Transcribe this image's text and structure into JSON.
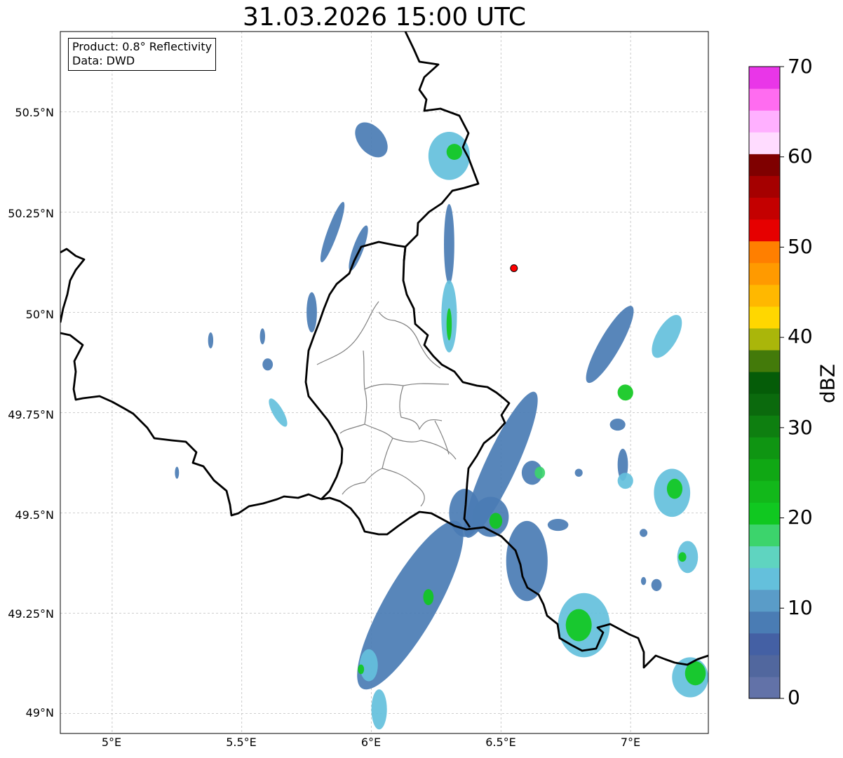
{
  "title": "31.03.2026 15:00 UTC",
  "info": {
    "product": "Product: 0.8° Reflectivity",
    "data": "Data: DWD"
  },
  "map": {
    "lon_range": [
      4.8,
      7.3
    ],
    "lat_range": [
      48.95,
      50.7
    ],
    "lat_ticks": [
      "50.5°N",
      "50.25°N",
      "50°N",
      "49.75°N",
      "49.5°N",
      "49.25°N",
      "49°N"
    ],
    "lon_ticks": [
      "5°E",
      "5.5°E",
      "6°E",
      "6.5°E",
      "7°E"
    ],
    "gridlines": true,
    "radar_site": {
      "lon": 6.55,
      "lat": 50.11,
      "color": "#ff0000"
    }
  },
  "colorbar": {
    "label": "dBZ",
    "min": 0,
    "max": 70,
    "ticks": [
      "0",
      "10",
      "20",
      "30",
      "40",
      "50",
      "60",
      "70"
    ],
    "colors": [
      "#6272a8",
      "#51679e",
      "#4460a4",
      "#4a7cb4",
      "#5a9cc8",
      "#64c0dc",
      "#5fd4c0",
      "#3cd46c",
      "#10c820",
      "#12b81a",
      "#10a814",
      "#0f9512",
      "#0e7f10",
      "#0b6a0d",
      "#055c08",
      "#437a0a",
      "#aab60a",
      "#ffd700",
      "#ffb800",
      "#ff9a00",
      "#ff7f00",
      "#e60000",
      "#c40000",
      "#a50000",
      "#7f0000",
      "#ffdcff",
      "#ffb0ff",
      "#ff6cf0",
      "#e936e8"
    ]
  },
  "echoes": [
    {
      "lon": 6.0,
      "lat": 50.43,
      "rx": 0.05,
      "ry": 0.05,
      "a": -40,
      "level": 1
    },
    {
      "lon": 6.3,
      "lat": 50.39,
      "rx": 0.08,
      "ry": 0.06,
      "a": 0,
      "level": 2
    },
    {
      "lon": 6.32,
      "lat": 50.4,
      "rx": 0.03,
      "ry": 0.02,
      "a": 0,
      "level": 4
    },
    {
      "lon": 6.3,
      "lat": 50.17,
      "rx": 0.02,
      "ry": 0.1,
      "a": 0,
      "level": 1
    },
    {
      "lon": 5.95,
      "lat": 50.16,
      "rx": 0.02,
      "ry": 0.06,
      "a": 20,
      "level": 1
    },
    {
      "lon": 5.85,
      "lat": 50.2,
      "rx": 0.02,
      "ry": 0.08,
      "a": 20,
      "level": 1
    },
    {
      "lon": 6.3,
      "lat": 49.99,
      "rx": 0.03,
      "ry": 0.09,
      "a": 0,
      "level": 2
    },
    {
      "lon": 6.3,
      "lat": 49.97,
      "rx": 0.01,
      "ry": 0.04,
      "a": 0,
      "level": 4
    },
    {
      "lon": 5.77,
      "lat": 50.0,
      "rx": 0.02,
      "ry": 0.05,
      "a": 0,
      "level": 1
    },
    {
      "lon": 5.58,
      "lat": 49.94,
      "rx": 0.01,
      "ry": 0.02,
      "a": 0,
      "level": 1
    },
    {
      "lon": 5.6,
      "lat": 49.87,
      "rx": 0.02,
      "ry": 0.015,
      "a": 0,
      "level": 1
    },
    {
      "lon": 5.64,
      "lat": 49.75,
      "rx": 0.02,
      "ry": 0.04,
      "a": -30,
      "level": 2
    },
    {
      "lon": 6.92,
      "lat": 49.92,
      "rx": 0.04,
      "ry": 0.11,
      "a": 30,
      "level": 1
    },
    {
      "lon": 7.14,
      "lat": 49.94,
      "rx": 0.04,
      "ry": 0.06,
      "a": 30,
      "level": 2
    },
    {
      "lon": 6.98,
      "lat": 49.8,
      "rx": 0.03,
      "ry": 0.02,
      "a": -20,
      "level": 4
    },
    {
      "lon": 6.95,
      "lat": 49.72,
      "rx": 0.03,
      "ry": 0.015,
      "a": 0,
      "level": 1
    },
    {
      "lon": 6.97,
      "lat": 49.62,
      "rx": 0.02,
      "ry": 0.04,
      "a": 0,
      "level": 1
    },
    {
      "lon": 6.98,
      "lat": 49.58,
      "rx": 0.03,
      "ry": 0.02,
      "a": 0,
      "level": 2
    },
    {
      "lon": 7.16,
      "lat": 49.55,
      "rx": 0.07,
      "ry": 0.06,
      "a": 0,
      "level": 2
    },
    {
      "lon": 7.17,
      "lat": 49.56,
      "rx": 0.03,
      "ry": 0.025,
      "a": 0,
      "level": 4
    },
    {
      "lon": 7.22,
      "lat": 49.39,
      "rx": 0.04,
      "ry": 0.04,
      "a": 0,
      "level": 2
    },
    {
      "lon": 7.2,
      "lat": 49.39,
      "rx": 0.015,
      "ry": 0.012,
      "a": 0,
      "level": 4
    },
    {
      "lon": 7.1,
      "lat": 49.32,
      "rx": 0.02,
      "ry": 0.015,
      "a": 0,
      "level": 1
    },
    {
      "lon": 6.82,
      "lat": 49.22,
      "rx": 0.1,
      "ry": 0.08,
      "a": 0,
      "level": 2
    },
    {
      "lon": 6.8,
      "lat": 49.22,
      "rx": 0.05,
      "ry": 0.04,
      "a": 0,
      "level": 4
    },
    {
      "lon": 7.23,
      "lat": 49.09,
      "rx": 0.07,
      "ry": 0.05,
      "a": 0,
      "level": 2
    },
    {
      "lon": 7.25,
      "lat": 49.1,
      "rx": 0.04,
      "ry": 0.03,
      "a": 0,
      "level": 4
    },
    {
      "lon": 6.6,
      "lat": 49.38,
      "rx": 0.08,
      "ry": 0.1,
      "a": 0,
      "level": 1
    },
    {
      "lon": 6.46,
      "lat": 49.49,
      "rx": 0.07,
      "ry": 0.05,
      "a": 0,
      "level": 1
    },
    {
      "lon": 6.48,
      "lat": 49.48,
      "rx": 0.025,
      "ry": 0.02,
      "a": 0,
      "level": 4
    },
    {
      "lon": 6.72,
      "lat": 49.47,
      "rx": 0.04,
      "ry": 0.015,
      "a": 0,
      "level": 1
    },
    {
      "lon": 6.62,
      "lat": 49.6,
      "rx": 0.04,
      "ry": 0.03,
      "a": 0,
      "level": 1
    },
    {
      "lon": 6.65,
      "lat": 49.6,
      "rx": 0.02,
      "ry": 0.015,
      "a": 0,
      "level": 3
    },
    {
      "lon": 6.8,
      "lat": 49.6,
      "rx": 0.015,
      "ry": 0.01,
      "a": 0,
      "level": 1
    },
    {
      "lon": 6.5,
      "lat": 49.62,
      "rx": 0.06,
      "ry": 0.2,
      "a": 25,
      "level": 1
    },
    {
      "lon": 6.15,
      "lat": 49.27,
      "rx": 0.1,
      "ry": 0.24,
      "a": 30,
      "level": 1
    },
    {
      "lon": 6.22,
      "lat": 49.29,
      "rx": 0.02,
      "ry": 0.02,
      "a": 0,
      "level": 4
    },
    {
      "lon": 5.99,
      "lat": 49.12,
      "rx": 0.035,
      "ry": 0.04,
      "a": 0,
      "level": 2
    },
    {
      "lon": 5.96,
      "lat": 49.11,
      "rx": 0.012,
      "ry": 0.012,
      "a": 0,
      "level": 4
    },
    {
      "lon": 6.03,
      "lat": 49.01,
      "rx": 0.03,
      "ry": 0.05,
      "a": 0,
      "level": 2
    },
    {
      "lon": 6.36,
      "lat": 49.5,
      "rx": 0.06,
      "ry": 0.06,
      "a": 0,
      "level": 1
    },
    {
      "lon": 5.25,
      "lat": 49.6,
      "rx": 0.008,
      "ry": 0.015,
      "a": 0,
      "level": 1
    },
    {
      "lon": 5.38,
      "lat": 49.93,
      "rx": 0.01,
      "ry": 0.02,
      "a": 0,
      "level": 1
    },
    {
      "lon": 7.05,
      "lat": 49.45,
      "rx": 0.015,
      "ry": 0.01,
      "a": 0,
      "level": 1
    },
    {
      "lon": 7.05,
      "lat": 49.33,
      "rx": 0.01,
      "ry": 0.01,
      "a": 0,
      "level": 1
    }
  ]
}
